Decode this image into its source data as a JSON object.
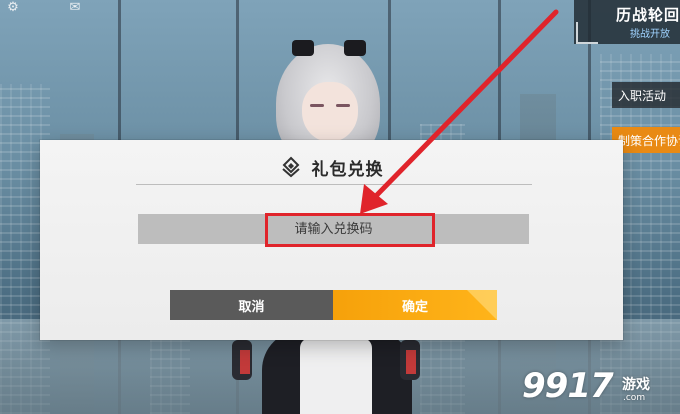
{
  "hud": {
    "event_title": "历战轮回",
    "event_subtitle": "挑战开放",
    "tab_entry": "入职活动",
    "tab_cooperation": "制策合作协议"
  },
  "dialog": {
    "title": "礼包兑换",
    "icon": "gift-emblem-icon",
    "input_value": "",
    "input_placeholder": "请输入兑换码",
    "cancel_label": "取消",
    "confirm_label": "确定"
  },
  "annotation": {
    "color": "#e0242b"
  },
  "watermark": {
    "logo_text": "9917",
    "sub": "游戏",
    "url": ".com"
  },
  "colors": {
    "dialog_bg": "#f0f0f0",
    "input_bg": "#bdbdbd",
    "cancel_bg": "#5a5a5a",
    "confirm_bg": "#f6a10a",
    "hud_accent": "#e98a14"
  }
}
